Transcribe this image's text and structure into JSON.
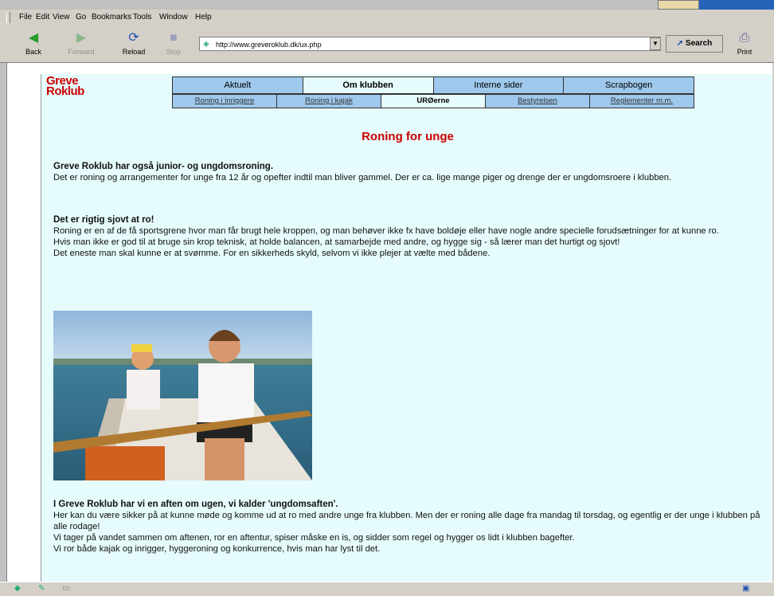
{
  "menu": {
    "items": [
      "File",
      "Edit",
      "View",
      "Go",
      "Bookmarks",
      "Tools",
      "Window",
      "Help"
    ]
  },
  "toolbar": {
    "back": "Back",
    "forward": "Forward",
    "reload": "Reload",
    "stop": "Stop",
    "url": "http://www.greveroklub.dk/ux.php",
    "search": "Search",
    "print": "Print"
  },
  "site": {
    "logo_line1": "Greve",
    "logo_line2": "Roklub",
    "nav_primary": [
      "Aktuelt",
      "Om klubben",
      "Interne sider",
      "Scrapbogen"
    ],
    "nav_secondary": [
      "Roning i inriggere",
      "Roning i kajak",
      "URØerne",
      "Bestyrelsen",
      "Reglementer m.m."
    ]
  },
  "page": {
    "title": "Roning for unge",
    "p1_heading": "Greve Roklub har også junior- og ungdomsroning.",
    "p1_text": "Det er roning og arrangementer for unge fra 12 år og opefter indtil man bliver gammel. Der er ca. lige mange piger og drenge der er ungdomsroere i klubben.",
    "p2_heading": "Det er rigtig sjovt at ro!",
    "p2_line1": "Roning er en af de få sportsgrene hvor man får brugt hele kroppen, og man behøver ikke fx have boldøje eller have nogle andre specielle forudsætninger for at kunne ro.",
    "p2_line2": "Hvis man ikke er god til at bruge sin krop teknisk, at holde balancen, at samarbejde med andre, og hygge sig - så lærer man det hurtigt og sjovt!",
    "p2_line3": "Det eneste man skal kunne er at svømme. For en sikkerheds skyld, selvom vi ikke plejer at vælte med bådene.",
    "p3_heading": "I Greve Roklub har vi en aften om ugen, vi kalder 'ungdomsaften'.",
    "p3_line1": "Her kan du være sikker på at kunne møde og komme ud at ro med andre unge fra klubben. Men der er roning alle dage fra mandag til torsdag, og egentlig er der unge i klubben på alle rodage!",
    "p3_line2": "Vi tager på vandet sammen om aftenen, ror en aftentur, spiser måske en is, og sidder som regel og hygger os lidt i klubben bagefter.",
    "p3_line3": "Vi ror både kajak og inrigger, hyggeroning og konkurrence, hvis man har lyst til det."
  },
  "colors": {
    "nav_bg": "#9ec8ec",
    "content_bg": "#e6fbfc",
    "accent_red": "#cc0000"
  }
}
